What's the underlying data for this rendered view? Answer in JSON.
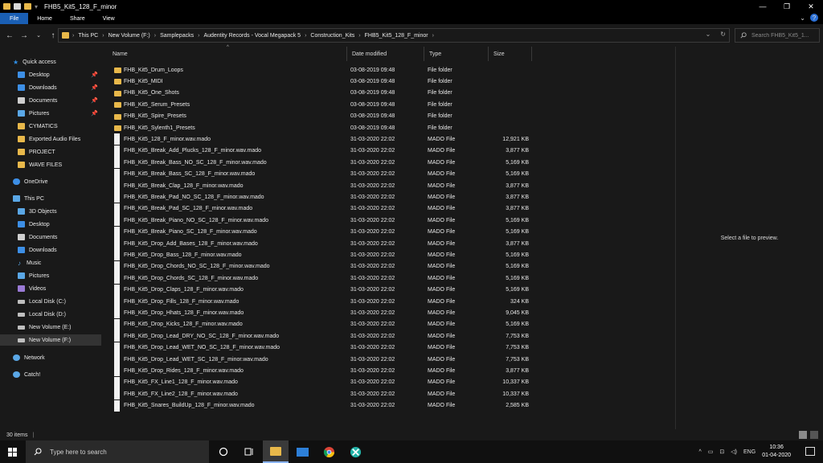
{
  "window": {
    "title": "FHB5_Kit5_128_F_minor",
    "minimize": "—",
    "maximize": "❐",
    "close": "✕"
  },
  "ribbon": {
    "tabs": [
      "File",
      "Home",
      "Share",
      "View"
    ],
    "expand": "⌄",
    "help": "?"
  },
  "nav": {
    "back": "←",
    "forward": "→",
    "recent": "⌄",
    "up": "↑"
  },
  "address": {
    "crumbs": [
      "This PC",
      "New Volume (F:)",
      "Samplepacks",
      "Audentity Records - Vocal Megapack 5",
      "Construction_Kits",
      "FHB5_Kit5_128_F_minor"
    ],
    "separator": "›",
    "dropdown": "⌄",
    "refresh": "↻"
  },
  "search": {
    "placeholder": "Search FHB5_Kit5_1..."
  },
  "navpane": {
    "items": [
      {
        "label": "Quick access",
        "icon": "star-icon",
        "color": "#2f8fe8",
        "indent": 0
      },
      {
        "label": "Desktop",
        "icon": "desktop-icon",
        "color": "#3d8fe6",
        "indent": 1,
        "pinned": true
      },
      {
        "label": "Downloads",
        "icon": "download-icon",
        "color": "#3d8fe6",
        "indent": 1,
        "pinned": true
      },
      {
        "label": "Documents",
        "icon": "documents-icon",
        "color": "#cfcfcf",
        "indent": 1,
        "pinned": true
      },
      {
        "label": "Pictures",
        "icon": "pictures-icon",
        "color": "#5aa7e6",
        "indent": 1,
        "pinned": true
      },
      {
        "label": "CYMATICS",
        "icon": "folder-icon",
        "color": "#e8b84a",
        "indent": 1
      },
      {
        "label": "Exported Audio Files",
        "icon": "folder-icon",
        "color": "#e8b84a",
        "indent": 1
      },
      {
        "label": "PROJECT",
        "icon": "folder-icon",
        "color": "#e8b84a",
        "indent": 1
      },
      {
        "label": "WAVE FILES",
        "icon": "folder-icon",
        "color": "#e8b84a",
        "indent": 1
      },
      {
        "label": "OneDrive",
        "icon": "cloud-icon",
        "color": "#3d8fe6",
        "indent": 0
      },
      {
        "label": "This PC",
        "icon": "computer-icon",
        "color": "#5aa7e6",
        "indent": 0
      },
      {
        "label": "3D Objects",
        "icon": "3d-objects-icon",
        "color": "#5aa7e6",
        "indent": 1
      },
      {
        "label": "Desktop",
        "icon": "desktop-icon",
        "color": "#3d8fe6",
        "indent": 1
      },
      {
        "label": "Documents",
        "icon": "documents-icon",
        "color": "#cfcfcf",
        "indent": 1
      },
      {
        "label": "Downloads",
        "icon": "download-icon",
        "color": "#3d8fe6",
        "indent": 1
      },
      {
        "label": "Music",
        "icon": "music-icon",
        "color": "#5aa7e6",
        "indent": 1
      },
      {
        "label": "Pictures",
        "icon": "pictures-icon",
        "color": "#5aa7e6",
        "indent": 1
      },
      {
        "label": "Videos",
        "icon": "videos-icon",
        "color": "#9a7ad6",
        "indent": 1
      },
      {
        "label": "Local Disk (C:)",
        "icon": "drive-icon",
        "color": "#bfbfbf",
        "indent": 1
      },
      {
        "label": "Local Disk (D:)",
        "icon": "drive-icon",
        "color": "#bfbfbf",
        "indent": 1
      },
      {
        "label": "New Volume (E:)",
        "icon": "drive-icon",
        "color": "#bfbfbf",
        "indent": 1
      },
      {
        "label": "New Volume (F:)",
        "icon": "drive-icon",
        "color": "#bfbfbf",
        "indent": 1,
        "selected": true
      },
      {
        "label": "Network",
        "icon": "network-icon",
        "color": "#5aa7e6",
        "indent": 0
      },
      {
        "label": "Catch!",
        "icon": "catch-icon",
        "color": "#5aa7e6",
        "indent": 0
      }
    ]
  },
  "columns": {
    "name": "Name",
    "date": "Date modified",
    "type": "Type",
    "size": "Size",
    "sort": "^"
  },
  "files": [
    {
      "name": "FHB_Kit5_Drum_Loops",
      "date": "03-08-2019 09:48",
      "type": "File folder",
      "size": "",
      "kind": "folder"
    },
    {
      "name": "FHB_Kit5_MIDI",
      "date": "03-08-2019 09:48",
      "type": "File folder",
      "size": "",
      "kind": "folder"
    },
    {
      "name": "FHB_Kit5_One_Shots",
      "date": "03-08-2019 09:48",
      "type": "File folder",
      "size": "",
      "kind": "folder"
    },
    {
      "name": "FHB_Kit5_Serum_Presets",
      "date": "03-08-2019 09:48",
      "type": "File folder",
      "size": "",
      "kind": "folder"
    },
    {
      "name": "FHB_Kit5_Spire_Presets",
      "date": "03-08-2019 09:48",
      "type": "File folder",
      "size": "",
      "kind": "folder"
    },
    {
      "name": "FHB_Kit5_Sylenth1_Presets",
      "date": "03-08-2019 09:48",
      "type": "File folder",
      "size": "",
      "kind": "folder"
    },
    {
      "name": "FHB_Kit5_128_F_minor.wav.mado",
      "date": "31-03-2020 22:02",
      "type": "MADO File",
      "size": "12,921 KB",
      "kind": "file"
    },
    {
      "name": "FHB_Kit5_Break_Add_Plucks_128_F_minor.wav.mado",
      "date": "31-03-2020 22:02",
      "type": "MADO File",
      "size": "3,877 KB",
      "kind": "file"
    },
    {
      "name": "FHB_Kit5_Break_Bass_NO_SC_128_F_minor.wav.mado",
      "date": "31-03-2020 22:02",
      "type": "MADO File",
      "size": "5,169 KB",
      "kind": "file"
    },
    {
      "name": "FHB_Kit5_Break_Bass_SC_128_F_minor.wav.mado",
      "date": "31-03-2020 22:02",
      "type": "MADO File",
      "size": "5,169 KB",
      "kind": "file"
    },
    {
      "name": "FHB_Kit5_Break_Clap_128_F_minor.wav.mado",
      "date": "31-03-2020 22:02",
      "type": "MADO File",
      "size": "3,877 KB",
      "kind": "file"
    },
    {
      "name": "FHB_Kit5_Break_Pad_NO_SC_128_F_minor.wav.mado",
      "date": "31-03-2020 22:02",
      "type": "MADO File",
      "size": "3,877 KB",
      "kind": "file"
    },
    {
      "name": "FHB_Kit5_Break_Pad_SC_128_F_minor.wav.mado",
      "date": "31-03-2020 22:02",
      "type": "MADO File",
      "size": "3,877 KB",
      "kind": "file"
    },
    {
      "name": "FHB_Kit5_Break_Piano_NO_SC_128_F_minor.wav.mado",
      "date": "31-03-2020 22:02",
      "type": "MADO File",
      "size": "5,169 KB",
      "kind": "file"
    },
    {
      "name": "FHB_Kit5_Break_Piano_SC_128_F_minor.wav.mado",
      "date": "31-03-2020 22:02",
      "type": "MADO File",
      "size": "5,169 KB",
      "kind": "file"
    },
    {
      "name": "FHB_Kit5_Drop_Add_Bases_128_F_minor.wav.mado",
      "date": "31-03-2020 22:02",
      "type": "MADO File",
      "size": "3,877 KB",
      "kind": "file"
    },
    {
      "name": "FHB_Kit5_Drop_Bass_128_F_minor.wav.mado",
      "date": "31-03-2020 22:02",
      "type": "MADO File",
      "size": "5,169 KB",
      "kind": "file"
    },
    {
      "name": "FHB_Kit5_Drop_Chords_NO_SC_128_F_minor.wav.mado",
      "date": "31-03-2020 22:02",
      "type": "MADO File",
      "size": "5,169 KB",
      "kind": "file"
    },
    {
      "name": "FHB_Kit5_Drop_Chords_SC_128_F_minor.wav.mado",
      "date": "31-03-2020 22:02",
      "type": "MADO File",
      "size": "5,169 KB",
      "kind": "file"
    },
    {
      "name": "FHB_Kit5_Drop_Claps_128_F_minor.wav.mado",
      "date": "31-03-2020 22:02",
      "type": "MADO File",
      "size": "5,169 KB",
      "kind": "file"
    },
    {
      "name": "FHB_Kit5_Drop_Fills_128_F_minor.wav.mado",
      "date": "31-03-2020 22:02",
      "type": "MADO File",
      "size": "324 KB",
      "kind": "file"
    },
    {
      "name": "FHB_Kit5_Drop_Hhats_128_F_minor.wav.mado",
      "date": "31-03-2020 22:02",
      "type": "MADO File",
      "size": "9,045 KB",
      "kind": "file"
    },
    {
      "name": "FHB_Kit5_Drop_Kicks_128_F_minor.wav.mado",
      "date": "31-03-2020 22:02",
      "type": "MADO File",
      "size": "5,169 KB",
      "kind": "file"
    },
    {
      "name": "FHB_Kit5_Drop_Lead_DRY_NO_SC_128_F_minor.wav.mado",
      "date": "31-03-2020 22:02",
      "type": "MADO File",
      "size": "7,753 KB",
      "kind": "file"
    },
    {
      "name": "FHB_Kit5_Drop_Lead_WET_NO_SC_128_F_minor.wav.mado",
      "date": "31-03-2020 22:02",
      "type": "MADO File",
      "size": "7,753 KB",
      "kind": "file"
    },
    {
      "name": "FHB_Kit5_Drop_Lead_WET_SC_128_F_minor.wav.mado",
      "date": "31-03-2020 22:02",
      "type": "MADO File",
      "size": "7,753 KB",
      "kind": "file"
    },
    {
      "name": "FHB_Kit5_Drop_Rides_128_F_minor.wav.mado",
      "date": "31-03-2020 22:02",
      "type": "MADO File",
      "size": "3,877 KB",
      "kind": "file"
    },
    {
      "name": "FHB_Kit5_FX_Line1_128_F_minor.wav.mado",
      "date": "31-03-2020 22:02",
      "type": "MADO File",
      "size": "10,337 KB",
      "kind": "file"
    },
    {
      "name": "FHB_Kit5_FX_Line2_128_F_minor.wav.mado",
      "date": "31-03-2020 22:02",
      "type": "MADO File",
      "size": "10,337 KB",
      "kind": "file"
    },
    {
      "name": "FHB_Kit5_Snares_BuildUp_128_F_minor.wav.mado",
      "date": "31-03-2020 22:02",
      "type": "MADO File",
      "size": "2,585 KB",
      "kind": "file"
    }
  ],
  "preview": {
    "text": "Select a file to preview."
  },
  "status": {
    "count": "30 items",
    "separator": "|"
  },
  "taskbar": {
    "search_placeholder": "Type here to search",
    "lang": "ENG",
    "time": "10:36",
    "date": "01-04-2020",
    "tray_chevron": "^"
  }
}
